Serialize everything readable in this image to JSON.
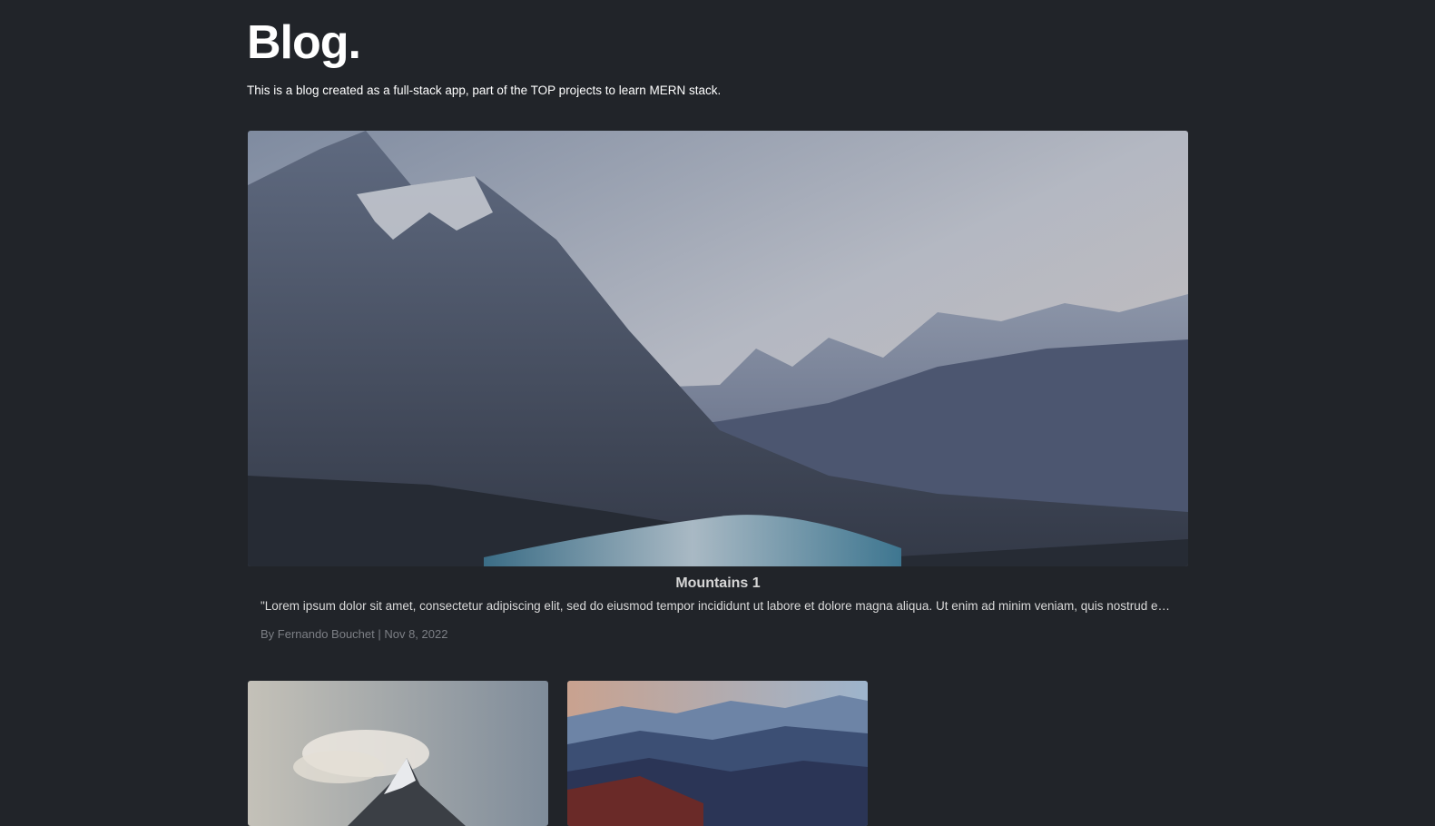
{
  "header": {
    "title": "Blog.",
    "subtitle": "This is a blog created as a full-stack app, part of the TOP projects to learn MERN stack."
  },
  "featured_post": {
    "image": "mountain-lake-landscape",
    "title": "Mountains 1",
    "excerpt": "\"Lorem ipsum dolor sit amet, consectetur adipiscing elit, sed do eiusmod tempor incididunt ut labore et dolore magna aliqua. Ut enim ad minim veniam, quis nostrud exercitatio...",
    "meta": "By Fernando Bouchet | Nov 8, 2022"
  },
  "posts": [
    {
      "image": "snowy-peak-with-clouds"
    },
    {
      "image": "mountain-range-sunset"
    }
  ],
  "colors": {
    "background": "#212429",
    "text": "#ffffff",
    "meta_text": "#7c7f85"
  }
}
